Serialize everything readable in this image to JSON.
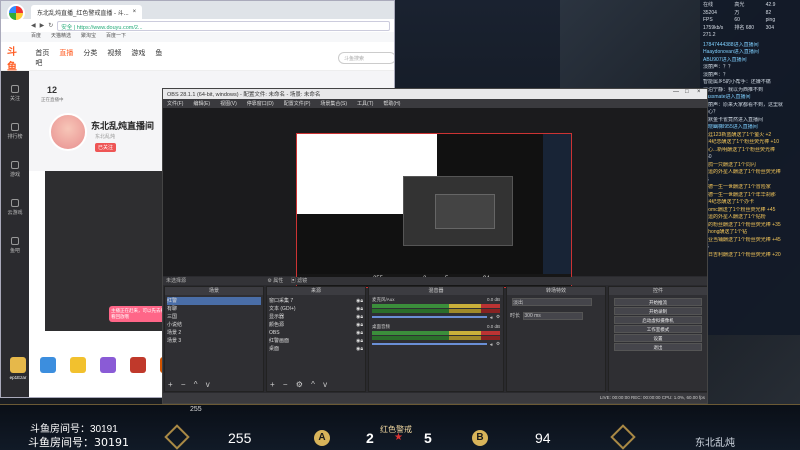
{
  "browser": {
    "tab_title": "东北乱炖直播_红色警戒直播 - 斗...",
    "url": "https://www.douyu.com/2...",
    "url_prefix": "安全",
    "bookmarks": [
      "百度",
      "天猫精选",
      "聚淘宝",
      "百度一下"
    ],
    "logo": "斗鱼",
    "nav": [
      "首页",
      "直播",
      "分类",
      "视频",
      "游戏",
      "鱼吧"
    ],
    "search_placeholder": "斗鱼搜索",
    "left_nav": [
      "关注",
      "排行榜",
      "游戏",
      "云游戏",
      "鱼吧"
    ],
    "level": "12",
    "level_sub": "正在直播中",
    "room_title": "东北乱炖直播间",
    "room_sub": "东北乱炖",
    "follow_tag": "已关注",
    "notice": "主播正在赶来，可以先去看看回放哦"
  },
  "chat": {
    "stats": [
      "在线",
      "高光",
      "42.9",
      "35204",
      "万",
      "82",
      "FPS",
      "60",
      "ping",
      "1759kb/s",
      "排名 680",
      "304",
      "271.2"
    ],
    "lines": [
      {
        "type": "user",
        "text": "17847444388进入直播间"
      },
      {
        "type": "user",
        "text": "Haaydonovan进入直播间"
      },
      {
        "type": "user",
        "text": "ABU907进入直播间"
      },
      {
        "type": "plain",
        "text": "淡丽声：？？"
      },
      {
        "type": "plain",
        "text": "淡丽声：？"
      },
      {
        "type": "plain",
        "text": "智能属乡5的小帮手：还嫌不痛"
      },
      {
        "type": "plain",
        "text": "淡泊宁静：我以为西推不到"
      },
      {
        "type": "user",
        "text": "classmate进入直播间"
      },
      {
        "type": "plain",
        "text": "淡丽声：原来大家都看不到，这里就"
      },
      {
        "type": "plain",
        "text": "很心？"
      },
      {
        "type": "plain",
        "text": "沉默金卡雀竟然进入直播间"
      },
      {
        "type": "user",
        "text": "天晓幽梯I955进入直播间"
      },
      {
        "type": "gift",
        "text": "依涯123新蓝酬送了1个萤火 +2"
      },
      {
        "type": "gift",
        "text": "124纪念酬送了1个粉丝荧光棒 +10"
      },
      {
        "type": "gift",
        "text": "心心...新明酬送了1个粉丝荧光棒"
      },
      {
        "type": "plain",
        "text": "+50"
      },
      {
        "type": "gift",
        "text": "金鸽一只酬送了1个同闪"
      },
      {
        "type": "gift",
        "text": "幸运的外星人酬送了1个粉丝荧光棒"
      },
      {
        "type": "plain",
        "text": "+5"
      },
      {
        "type": "gift",
        "text": "爱德一生一世酬送了1个冒险家"
      },
      {
        "type": "gift",
        "text": "爱德一生一世酬送了1个年华刹那"
      },
      {
        "type": "gift",
        "text": "124纪念酬送了1个办卡"
      },
      {
        "type": "gift",
        "text": "yoomc酬送了1个粉丝荧光棒 +45"
      },
      {
        "type": "gift",
        "text": "幸运的外星人酬送了1个钻粉"
      },
      {
        "type": "gift",
        "text": "再的粉丝酬送了1个粉丝荧光棒 +35"
      },
      {
        "type": "gift",
        "text": "pkhong酬送了1个钻"
      },
      {
        "type": "gift",
        "text": "专业当铺酬送了1个粉丝荧光棒 +45"
      },
      {
        "type": "plain",
        "text": "+5"
      },
      {
        "type": "gift",
        "text": "首日吉利酬送了1个粉丝荧光棒 +20"
      }
    ]
  },
  "obs": {
    "title": "OBS 28.1.1 (64-bit, windows) - 配置文件: 未命名 - 场景: 未命名",
    "menu": [
      "文件(F)",
      "编辑(E)",
      "视图(V)",
      "停靠窗口(D)",
      "配置文件(P)",
      "场景集合(S)",
      "工具(T)",
      "帮助(H)"
    ],
    "scenebar_label": "未选择源",
    "properties_btn": "属性",
    "filters_btn": "滤镜",
    "docks": {
      "scenes": {
        "title": "场景",
        "items": [
          "红警",
          "有聊",
          "三国",
          "小说结",
          "场景 2",
          "场景 3"
        ],
        "selected": 0
      },
      "sources": {
        "title": "来源",
        "items": [
          "窗口采集 7",
          "文本 (GDI+)",
          "显示器",
          "颜色源",
          "OBS",
          "红警画面",
          "桌面"
        ]
      },
      "mixer": {
        "title": "混音器",
        "channels": [
          {
            "name": "麦克风/Aux",
            "db": "0.0 dB"
          },
          {
            "name": "桌面音频",
            "db": "0.0 dB"
          }
        ]
      },
      "transitions": {
        "title": "转场特效",
        "type": "淡出",
        "duration_label": "时长",
        "duration": "300 ms"
      },
      "controls": {
        "title": "控件",
        "buttons": [
          "开始推流",
          "开始录制",
          "启动虚拟摄像机",
          "工作室模式",
          "设置",
          "退出"
        ]
      }
    },
    "status": "LIVE: 00:00:00   REC: 00:00:00   CPU: 1.0%, 60.00 fps"
  },
  "nested_hud": {
    "score_a": "255",
    "kills_a": "2",
    "kills_b": "5",
    "score_b": "94"
  },
  "desktop_icons": [
    {
      "label": "ep1Ezar",
      "color": "#e6b84a"
    },
    {
      "label": "暴风影音16",
      "color": "#3c8ede"
    },
    {
      "label": "YY语音",
      "color": "#f2c12e"
    },
    {
      "label": "心得测验",
      "color": "#8a5bd6"
    },
    {
      "label": "红色警戒",
      "color": "#c0392b"
    },
    {
      "label": "5.2版本",
      "color": "#d35400"
    }
  ],
  "hud": {
    "room_label": "斗鱼房间号：30191",
    "room_label_top": "斗鱼房间号：30191",
    "score_a": "255",
    "badge_a": "A",
    "kills_a": "2",
    "kills_b": "5",
    "badge_b": "B",
    "team_name": "红色警戒",
    "score_b": "94",
    "player_name": "东北乱炖",
    "mini_score": "255"
  },
  "colors": {
    "brand": "#ff5d23",
    "gold": "#d8b45a",
    "live_red": "#cc3333"
  }
}
